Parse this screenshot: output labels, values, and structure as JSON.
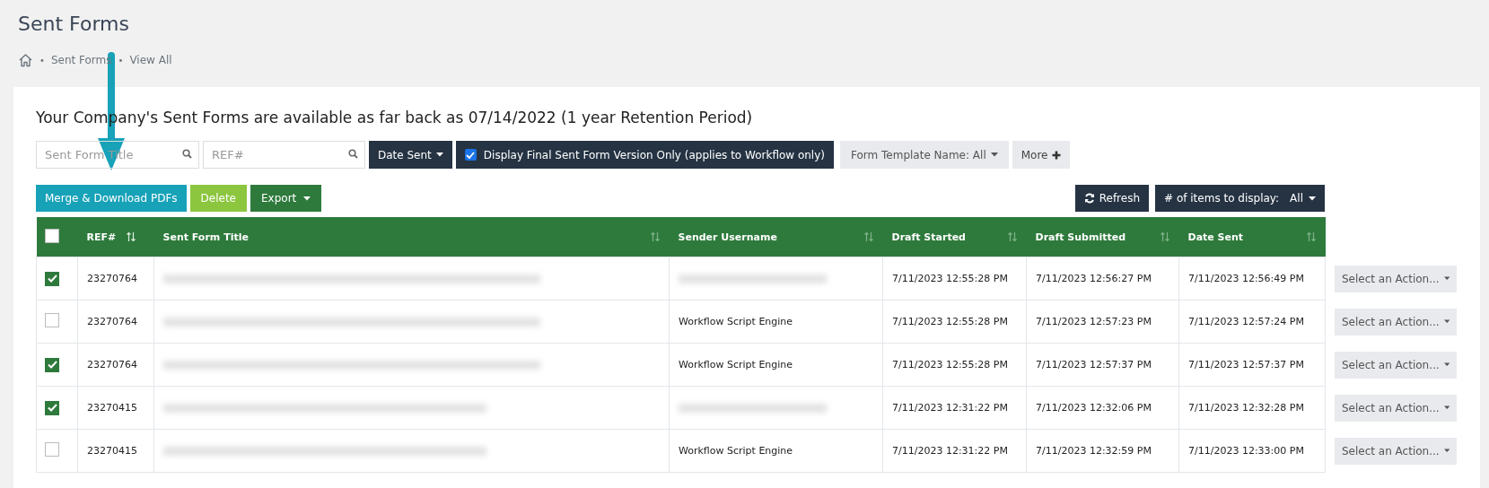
{
  "page": {
    "title": "Sent Forms"
  },
  "breadcrumb": [
    {
      "separator": "•",
      "label": "Sent Forms"
    },
    {
      "separator": "•",
      "label": "View All"
    }
  ],
  "notice": "Your Company's Sent Forms are available as far back as 07/14/2022 (1 year Retention Period)",
  "filters": {
    "title_search": {
      "placeholder": "Sent Form Title"
    },
    "ref_search": {
      "placeholder": "REF#"
    },
    "date_button": "Date Sent",
    "final_version": {
      "label": "Display Final Sent Form Version Only (applies to Workflow only)",
      "checked": true
    },
    "template_button": "Form Template Name: All",
    "more_button": "More"
  },
  "actions": [
    {
      "label": "Merge & Download PDFs",
      "kind": "info",
      "dropdown": false
    },
    {
      "label": "Delete",
      "kind": "lime",
      "dropdown": false
    },
    {
      "label": "Export",
      "kind": "green",
      "dropdown": true
    }
  ],
  "refresh": "Refresh",
  "items_display": {
    "label": "# of items to display:",
    "value": "All"
  },
  "table": {
    "select_all_checked": false,
    "columns": [
      {
        "label": "REF#",
        "sorted": true
      },
      {
        "label": "Sent Form Title",
        "sorted": false
      },
      {
        "label": "Sender Username",
        "sorted": false
      },
      {
        "label": "Draft Started",
        "sorted": false
      },
      {
        "label": "Draft Submitted",
        "sorted": false
      },
      {
        "label": "Date Sent",
        "sorted": false
      }
    ],
    "rows": [
      {
        "checked": true,
        "ref": "23270764",
        "title_blurred": true,
        "sender_blurred": true,
        "draft_started": "7/11/2023 12:55:28 PM",
        "draft_submitted": "7/11/2023 12:56:27 PM",
        "date_sent": "7/11/2023 12:56:49 PM",
        "action": "Select an Action..."
      },
      {
        "checked": false,
        "ref": "23270764",
        "title_blurred": true,
        "sender": "Workflow Script Engine",
        "sender_blurred": false,
        "draft_started": "7/11/2023 12:55:28 PM",
        "draft_submitted": "7/11/2023 12:57:23 PM",
        "date_sent": "7/11/2023 12:57:24 PM",
        "action": "Select an Action..."
      },
      {
        "checked": true,
        "ref": "23270764",
        "title_blurred": true,
        "sender": "Workflow Script Engine",
        "sender_blurred": false,
        "draft_started": "7/11/2023 12:55:28 PM",
        "draft_submitted": "7/11/2023 12:57:37 PM",
        "date_sent": "7/11/2023 12:57:37 PM",
        "action": "Select an Action..."
      },
      {
        "checked": true,
        "ref": "23270415",
        "title_blurred": true,
        "sender_blurred": true,
        "draft_started": "7/11/2023 12:31:22 PM",
        "draft_submitted": "7/11/2023 12:32:06 PM",
        "date_sent": "7/11/2023 12:32:28 PM",
        "action": "Select an Action..."
      },
      {
        "checked": false,
        "ref": "23270415",
        "title_blurred": true,
        "sender": "Workflow Script Engine",
        "sender_blurred": false,
        "draft_started": "7/11/2023 12:31:22 PM",
        "draft_submitted": "7/11/2023 12:32:59 PM",
        "date_sent": "7/11/2023 12:33:00 PM",
        "action": "Select an Action..."
      }
    ]
  }
}
